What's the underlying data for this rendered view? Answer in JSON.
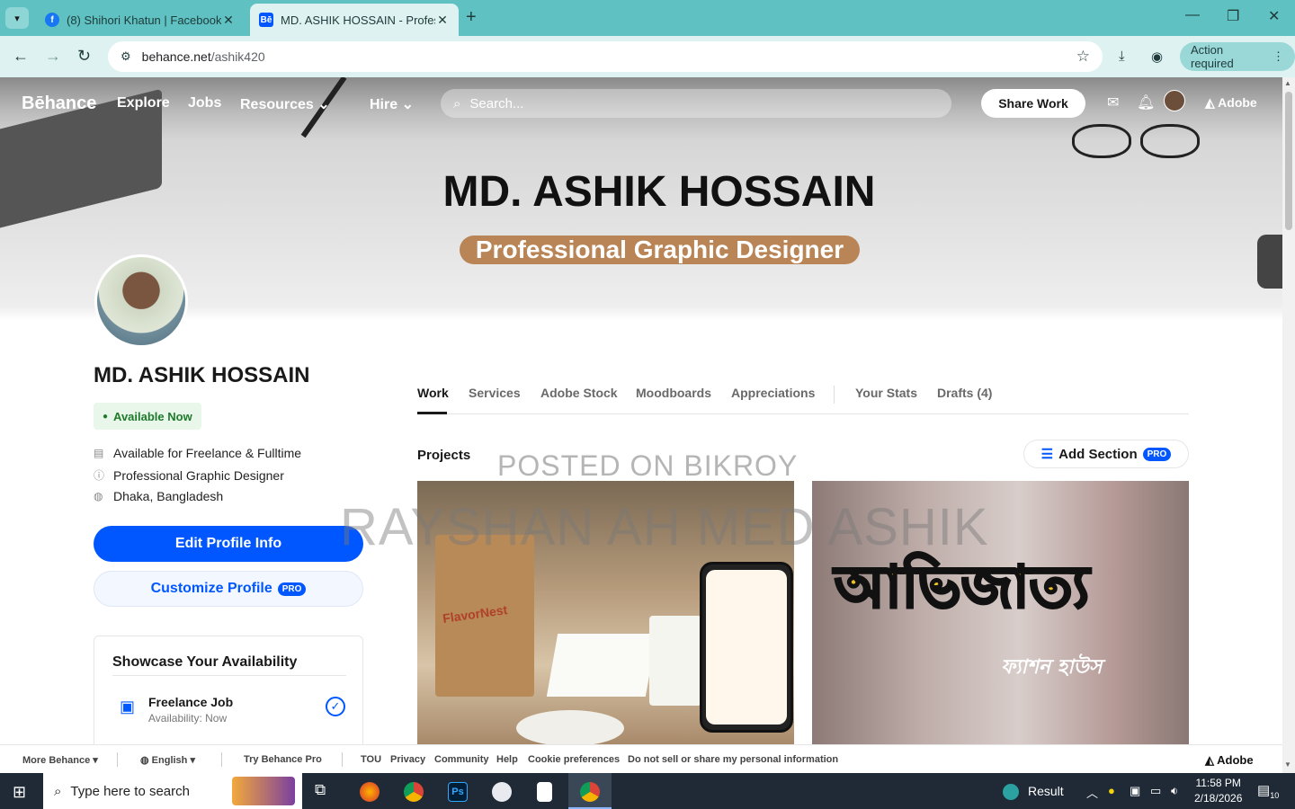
{
  "browser": {
    "tabs": [
      {
        "title": "(8) Shihori Khatun | Facebook",
        "favicon": "f"
      },
      {
        "title": "MD. ASHIK HOSSAIN - Professi",
        "favicon": "Bē"
      }
    ],
    "url_domain": "behance.net",
    "url_path": "/ashik420",
    "action_required": "Action required"
  },
  "header": {
    "brand": "Bēhance",
    "nav": [
      "Explore",
      "Jobs",
      "Resources",
      "Hire"
    ],
    "search_placeholder": "Search...",
    "share_work": "Share Work",
    "adobe": "Adobe"
  },
  "banner": {
    "name": "MD. ASHIK HOSSAIN",
    "role": "Professional Graphic Designer"
  },
  "profile": {
    "name": "MD. ASHIK HOSSAIN",
    "availability_badge": "Available Now",
    "info": [
      "Available for Freelance & Fulltime",
      "Professional Graphic Designer",
      "Dhaka, Bangladesh"
    ],
    "edit_button": "Edit Profile Info",
    "customize_button": "Customize Profile",
    "pro_badge": "PRO",
    "showcase": {
      "title": "Showcase Your Availability",
      "item_title": "Freelance Job",
      "item_sub": "Availability: Now"
    }
  },
  "tabs": [
    "Work",
    "Services",
    "Adobe Stock",
    "Moodboards",
    "Appreciations",
    "Your Stats",
    "Drafts (4)"
  ],
  "projects": {
    "title": "Projects",
    "add_section": "Add Section",
    "pro_badge": "PRO",
    "p1_brand": "FlavorNest",
    "p2_title": "আভিজাত্য",
    "p2_sub": "ফ্যাশন হাউস"
  },
  "watermarks": [
    "POSTED ON BIKROY",
    "RAYSHAN AH MED ASHIK"
  ],
  "footer": {
    "more": "More Behance ▾",
    "language": "English ▾",
    "try_pro": "Try Behance Pro",
    "links": [
      "TOU",
      "Privacy",
      "Community",
      "Help",
      "Cookie preferences",
      "Do not sell or share my personal information"
    ],
    "adobe": "Adobe"
  },
  "taskbar": {
    "search_placeholder": "Type here to search",
    "result": "Result",
    "time": "11:58 PM",
    "date": "2/18/2026",
    "notif_count": "10"
  },
  "colors": {
    "accent": "#0057ff",
    "tabbar": "#5fc1c1",
    "role_pill": "#b98556",
    "available_green": "#1d7a2a"
  }
}
